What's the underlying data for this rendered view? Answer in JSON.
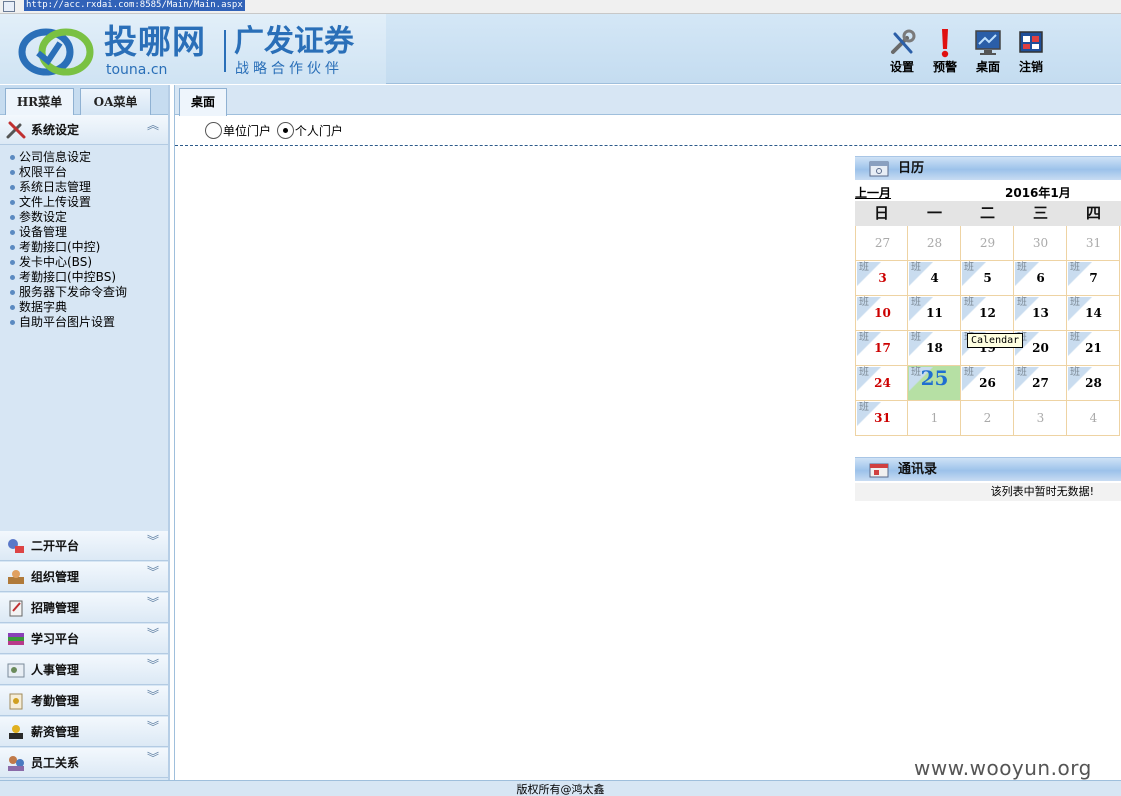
{
  "browser": {
    "url": "http://acc.rxdai.com:8585/Main/Main.aspx"
  },
  "header": {
    "logo_cn": "投哪网",
    "logo_domain": "touna.cn",
    "partner_name": "广发证券",
    "partner_slogan": "战略合作伙伴",
    "tools": [
      {
        "label": "设置",
        "icon": "settings-tools-icon"
      },
      {
        "label": "预警",
        "icon": "alert-icon"
      },
      {
        "label": "桌面",
        "icon": "desktop-icon"
      },
      {
        "label": "注销",
        "icon": "logout-icon"
      }
    ]
  },
  "sidebar": {
    "tabs": [
      "HR菜单",
      "OA菜单"
    ],
    "active_tab": "HR菜单",
    "expanded_section": {
      "title": "系统设定",
      "icon": "system-settings-icon",
      "items": [
        "公司信息设定",
        "权限平台",
        "系统日志管理",
        "文件上传设置",
        "参数设定",
        "设备管理",
        "考勤接口(中控)",
        "发卡中心(BS)",
        "考勤接口(中控BS)",
        "服务器下发命令查询",
        "数据字典",
        "自助平台图片设置"
      ]
    },
    "sections": [
      {
        "title": "二开平台",
        "icon": "dev-platform-icon"
      },
      {
        "title": "组织管理",
        "icon": "organization-icon"
      },
      {
        "title": "招聘管理",
        "icon": "recruitment-icon"
      },
      {
        "title": "学习平台",
        "icon": "learning-icon"
      },
      {
        "title": "人事管理",
        "icon": "personnel-icon"
      },
      {
        "title": "考勤管理",
        "icon": "attendance-icon"
      },
      {
        "title": "薪资管理",
        "icon": "salary-icon"
      },
      {
        "title": "员工关系",
        "icon": "employee-relations-icon"
      }
    ]
  },
  "main": {
    "tab": "桌面",
    "portal_options": [
      {
        "label": "单位门户",
        "checked": false
      },
      {
        "label": "个人门户",
        "checked": true
      }
    ]
  },
  "calendar": {
    "title": "日历",
    "prev_label": "上一月",
    "month_label": "2016年1月",
    "weekdays": [
      "日",
      "一",
      "二",
      "三",
      "四"
    ],
    "work_mark": "班",
    "tooltip": "Calendar",
    "today": 25,
    "rows": [
      [
        {
          "d": "27",
          "o": true
        },
        {
          "d": "28",
          "o": true
        },
        {
          "d": "29",
          "o": true
        },
        {
          "d": "30",
          "o": true
        },
        {
          "d": "31",
          "o": true
        }
      ],
      [
        {
          "d": "3",
          "b": true
        },
        {
          "d": "4",
          "b": true
        },
        {
          "d": "5",
          "b": true
        },
        {
          "d": "6",
          "b": true
        },
        {
          "d": "7",
          "b": true
        }
      ],
      [
        {
          "d": "10",
          "b": true
        },
        {
          "d": "11",
          "b": true
        },
        {
          "d": "12",
          "b": true
        },
        {
          "d": "13",
          "b": true
        },
        {
          "d": "14",
          "b": true
        }
      ],
      [
        {
          "d": "17",
          "b": true
        },
        {
          "d": "18",
          "b": true
        },
        {
          "d": "19",
          "b": true
        },
        {
          "d": "20",
          "b": true
        },
        {
          "d": "21",
          "b": true
        }
      ],
      [
        {
          "d": "24",
          "b": true
        },
        {
          "d": "25",
          "b": true
        },
        {
          "d": "26",
          "b": true
        },
        {
          "d": "27",
          "b": true
        },
        {
          "d": "28",
          "b": true
        }
      ],
      [
        {
          "d": "31",
          "b": true
        },
        {
          "d": "1",
          "o": true
        },
        {
          "d": "2",
          "o": true
        },
        {
          "d": "3",
          "o": true
        },
        {
          "d": "4",
          "o": true
        }
      ]
    ]
  },
  "contacts": {
    "title": "通讯录",
    "empty_text": "该列表中暂时无数据!"
  },
  "footer": {
    "copyright": "版权所有@鸿太鑫"
  },
  "watermark": "www.wooyun.org",
  "colors": {
    "accent": "#2a6fb8",
    "sunday": "#cc0000",
    "today_bg": "#b6e0a4",
    "today_text": "#1f6fd0",
    "panel_blue": "#9cc2ea"
  }
}
